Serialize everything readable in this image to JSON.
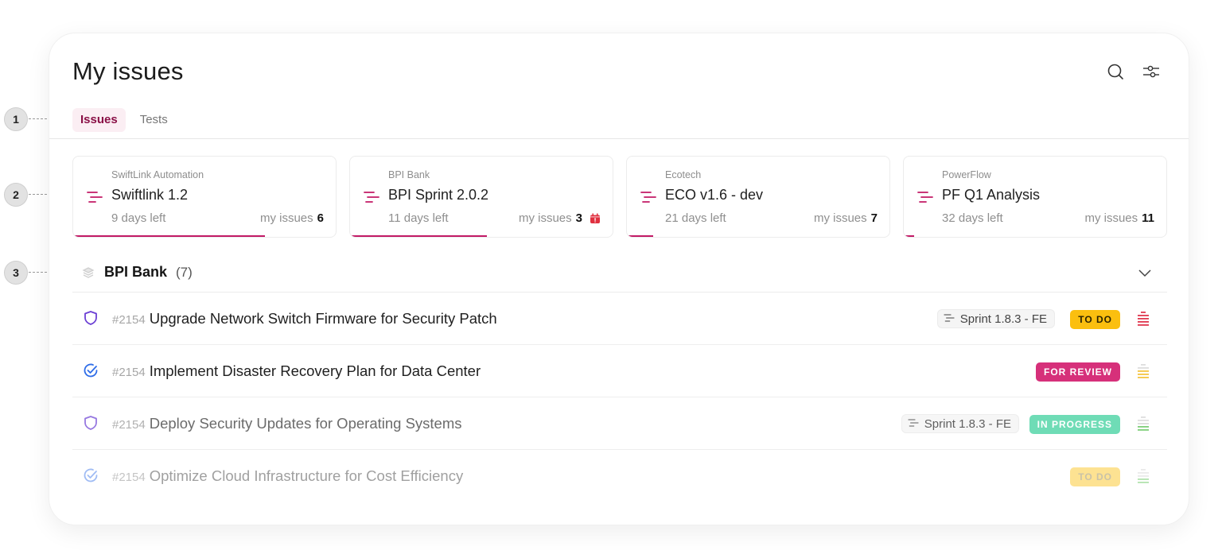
{
  "header": {
    "title": "My issues",
    "icons": [
      "search-icon",
      "filter-sliders-icon"
    ]
  },
  "tabs": [
    {
      "label": "Issues",
      "active": true
    },
    {
      "label": "Tests",
      "active": false
    }
  ],
  "sprint_cards": [
    {
      "client": "SwiftLink Automation",
      "name": "Swiftlink 1.2",
      "days_left": "9 days left",
      "my_issues_label": "my issues",
      "my_issues_count": "6",
      "alert": false,
      "progress": 0.73
    },
    {
      "client": "BPI Bank",
      "name": "BPI Sprint 2.0.2",
      "days_left": "11 days left",
      "my_issues_label": "my issues",
      "my_issues_count": "3",
      "alert": true,
      "progress": 0.52
    },
    {
      "client": "Ecotech",
      "name": "ECO v1.6 - dev",
      "days_left": "21 days left",
      "my_issues_label": "my issues",
      "my_issues_count": "7",
      "alert": false,
      "progress": 0.1
    },
    {
      "client": "PowerFlow",
      "name": "PF Q1 Analysis",
      "days_left": "32 days left",
      "my_issues_label": "my issues",
      "my_issues_count": "11",
      "alert": false,
      "progress": 0.04
    }
  ],
  "group": {
    "name": "BPI Bank",
    "count": "(7)",
    "expanded": true
  },
  "issues": [
    {
      "type": "shield",
      "number": "#2154",
      "title": "Upgrade Network Switch Firmware for Security Patch",
      "sprint": "Sprint 1.8.3 - FE",
      "status": "TO DO",
      "priority": "high",
      "faded": 0
    },
    {
      "type": "check",
      "number": "#2154",
      "title": "Implement Disaster Recovery Plan for Data Center",
      "sprint": "",
      "status": "FOR REVIEW",
      "priority": "medium",
      "faded": 0
    },
    {
      "type": "shield",
      "number": "#2154",
      "title": "Deploy Security Updates for Operating Systems",
      "sprint": "Sprint 1.8.3 - FE",
      "status": "IN PROGRESS",
      "priority": "low",
      "faded": 1
    },
    {
      "type": "check",
      "number": "#2154",
      "title": "Optimize Cloud Infrastructure for Cost Efficiency",
      "sprint": "",
      "status": "TO DO",
      "priority": "low",
      "faded": 2
    }
  ],
  "annotations": [
    "1",
    "2",
    "3"
  ],
  "colors": {
    "accent": "#c21a66",
    "tab_active_text": "#8a1046",
    "tab_active_bg": "#fbeef3",
    "status_todo": "#fbbf0f",
    "status_review": "#d6307a",
    "status_progress": "#6fdcb6",
    "priority_high": "#e0384f",
    "priority_medium": "#f5c542",
    "priority_low": "#7fcf7a",
    "shield": "#6b3fd4",
    "check": "#2f6de8"
  }
}
